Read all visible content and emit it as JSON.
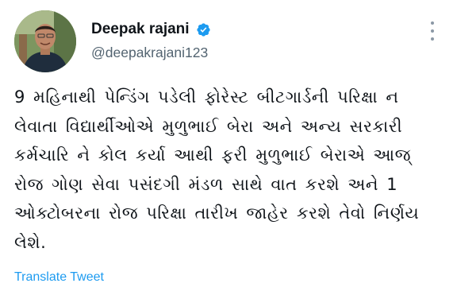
{
  "tweet": {
    "author": {
      "display_name": "Deepak rajani",
      "handle": "@deepakrajani123",
      "verified": true,
      "verified_icon": "verified-badge-icon",
      "avatar": "profile-photo"
    },
    "more_icon": "more-vertical-icon",
    "text": "9 મહિનાથી પેન્ડિંગ પડેલી ફોરેસ્ટ બીટગાર્ડની પરિક્ષા ન લેવાતા વિદ્યાર્થીઓએ મુળુભાઈ બેરા અને અન્ય સરકારી કર્મચારિ ને કોલ કર્યા આથી ફરી મુળુભાઈ બેરાએ આજ્ રોજ ગોણ સેવા પસંદગી મંડળ સાથે વાત કરશે અને 1 ઓક્ટોબરના રોજ પરિક્ષા તારીખ જાહેર કરશે તેવો નિર્ણય લેશે.",
    "translate_label": "Translate Tweet"
  },
  "colors": {
    "text_primary": "#0f1419",
    "text_secondary": "#536471",
    "accent_blue": "#1d9bf0",
    "background": "#ffffff"
  }
}
